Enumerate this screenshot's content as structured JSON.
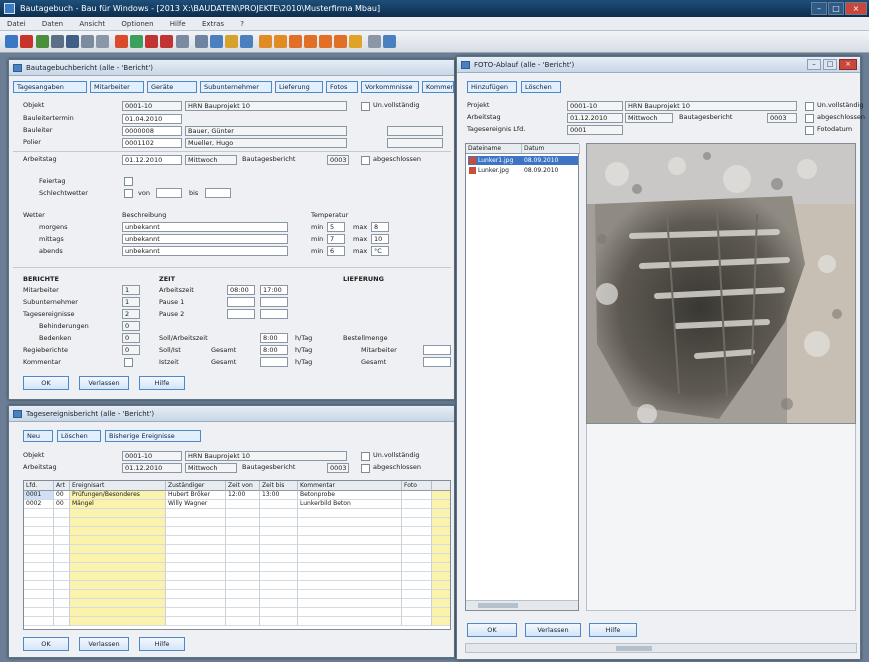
{
  "app": {
    "title": "Bautagebuch - Bau für Windows - [2013 X:\\BAUDATEN\\PROJEKTE\\2010\\Musterfirma Mbau]",
    "menu": [
      "Datei",
      "Daten",
      "Ansicht",
      "Optionen",
      "Hilfe",
      "Extras",
      "?"
    ]
  },
  "left_top": {
    "title": "Bautagebuchbericht (alle - 'Bericht')",
    "tabs": [
      "Tagesangaben",
      "Mitarbeiter",
      "Geräte",
      "Subunternehmer",
      "Lieferung",
      "Fotos",
      "Vorkommnisse",
      "Kommentar"
    ],
    "objekt_label": "Objekt",
    "objekt_nr": "0001-10",
    "objekt_name": "HRN Bauprojekt 10",
    "unvollstaendig": "Un.vollständig",
    "baustellentermin_label": "Bauleitertermin",
    "baustellentermin": "01.04.2010",
    "bauleiter_label": "Bauleiter",
    "bauleiter_nr": "0000008",
    "bauleiter_name": "Bauer, Günter",
    "polier_label": "Polier",
    "polier_nr": "0001102",
    "polier_name": "Mueller, Hugo",
    "arbeitstag_label": "Arbeitstag",
    "arbeitstag": "01.12.2010",
    "wochentag": "Mittwoch",
    "bautagesbericht_label": "Bautagesbericht",
    "bautagesbericht_nr": "0003",
    "abgeschlossen": "abgeschlossen",
    "feiertag_label": "Feiertag",
    "schlechtwetter_label": "Schlechtwetter",
    "von_label": "von",
    "bis_label": "bis",
    "wetter_label": "Wetter",
    "beschreibung_label": "Beschreibung",
    "temperatur_label": "Temperatur",
    "wetter_rows": [
      {
        "label": "morgens",
        "desc": "unbekannt",
        "min_l": "min",
        "min": "5",
        "max_l": "max",
        "max": "8"
      },
      {
        "label": "mittags",
        "desc": "unbekannt",
        "min_l": "min",
        "min": "7",
        "max_l": "max",
        "max": "10"
      },
      {
        "label": "abends",
        "desc": "unbekannt",
        "min_l": "min",
        "min": "6",
        "max_l": "max",
        "max": "°C"
      }
    ],
    "bereich_label": "BERICHTE",
    "zeit_label": "ZEIT",
    "lieferung_label": "LIEFERUNG",
    "mitarbeiter_label": "Mitarbeiter",
    "mitarbeiter_val": "1",
    "subunternehmer_label": "Subunternehmer",
    "subunternehmer_val": "1",
    "tagesereignisse_label": "Tagesereignisse",
    "tagesereignisse_val": "2",
    "behinderungen_label": "Behinderungen",
    "behinderungen_val": "0",
    "bedenken_label": "Bedenken",
    "bedenken_val": "0",
    "regieberichte_label": "Regieberichte",
    "regieberichte_val": "0",
    "kommentar_label": "Kommentar",
    "arbeitszeit_label": "Arbeitszeit",
    "arbeitszeit_von": "08:00",
    "arbeitszeit_bis": "17:00",
    "pause1_label": "Pause 1",
    "pause2_label": "Pause 2",
    "soll_label": "Soll/Arbeitszeit",
    "soll_val": "8:00",
    "soll_unit": "h/Tag",
    "ist_label": "Soll/Ist",
    "ist_val": "8:00",
    "ist_unit": "h/Tag",
    "istzeit_label": "Istzeit",
    "gesamt_label": "Gesamt",
    "gesamt2_label": "Gesamt",
    "gesamt3_label": "Gesamt",
    "bestellmenge_label": "Bestellmenge",
    "mitarbeiter2_label": "Mitarbeiter",
    "buttons": [
      "OK",
      "Verlassen",
      "Hilfe"
    ]
  },
  "left_bottom": {
    "title": "Tagesereignisbericht (alle - 'Bericht')",
    "tabs": [
      "Neu",
      "Löschen",
      "Bisherige Ereignisse"
    ],
    "objekt_label": "Objekt",
    "objekt_nr": "0001-10",
    "objekt_name": "HRN Bauprojekt 10",
    "unvollstaendig": "Un.vollständig",
    "arbeitstag_label": "Arbeitstag",
    "arbeitstag": "01.12.2010",
    "wochentag": "Mittwoch",
    "bautagesbericht_label": "Bautagesbericht",
    "bautagesbericht_nr": "0003",
    "abgeschlossen": "abgeschlossen",
    "columns": [
      "Lfd.",
      "Art",
      "Ereignisart",
      "Zuständiger",
      "Zeit von",
      "Zeit bis",
      "Kommentar",
      "Foto"
    ],
    "rows": [
      [
        "0001",
        "00",
        "Prüfungen/Besonderes",
        "Hubert Bröker",
        "12:00",
        "13:00",
        "Betonprobe",
        ""
      ],
      [
        "0002",
        "00",
        "Mängel",
        "Willy Wagner",
        "",
        "",
        "Lunkerbild Beton",
        ""
      ]
    ],
    "buttons": [
      "OK",
      "Verlassen",
      "Hilfe"
    ]
  },
  "right": {
    "title": "FOTO-Ablauf (alle - 'Bericht')",
    "tabs": [
      "Hinzufügen",
      "Löschen"
    ],
    "projekt_label": "Projekt",
    "projekt_nr": "0001-10",
    "projekt_name": "HRN Bauprojekt 10",
    "arbeitstag_label": "Arbeitstag",
    "arbeitstag": "01.12.2010",
    "wochentag": "Mittwoch",
    "bautagesbericht_label": "Bautagesbericht",
    "bautagesbericht_nr": "0003",
    "tagesereignis_label": "Tagesereignis Lfd.",
    "tagesereignis_nr": "0001",
    "unvollstaendig": "Un.vollständig",
    "abgeschlossen": "abgeschlossen",
    "fotodatum": "Fotodatum",
    "list_cols": [
      "Dateiname",
      "Datum"
    ],
    "files": [
      {
        "name": "Lunker1.jpg",
        "date": "08.09.2010"
      },
      {
        "name": "Lunker.jpg",
        "date": "08.09.2010"
      }
    ],
    "buttons": [
      "OK",
      "Verlassen",
      "Hilfe"
    ]
  }
}
